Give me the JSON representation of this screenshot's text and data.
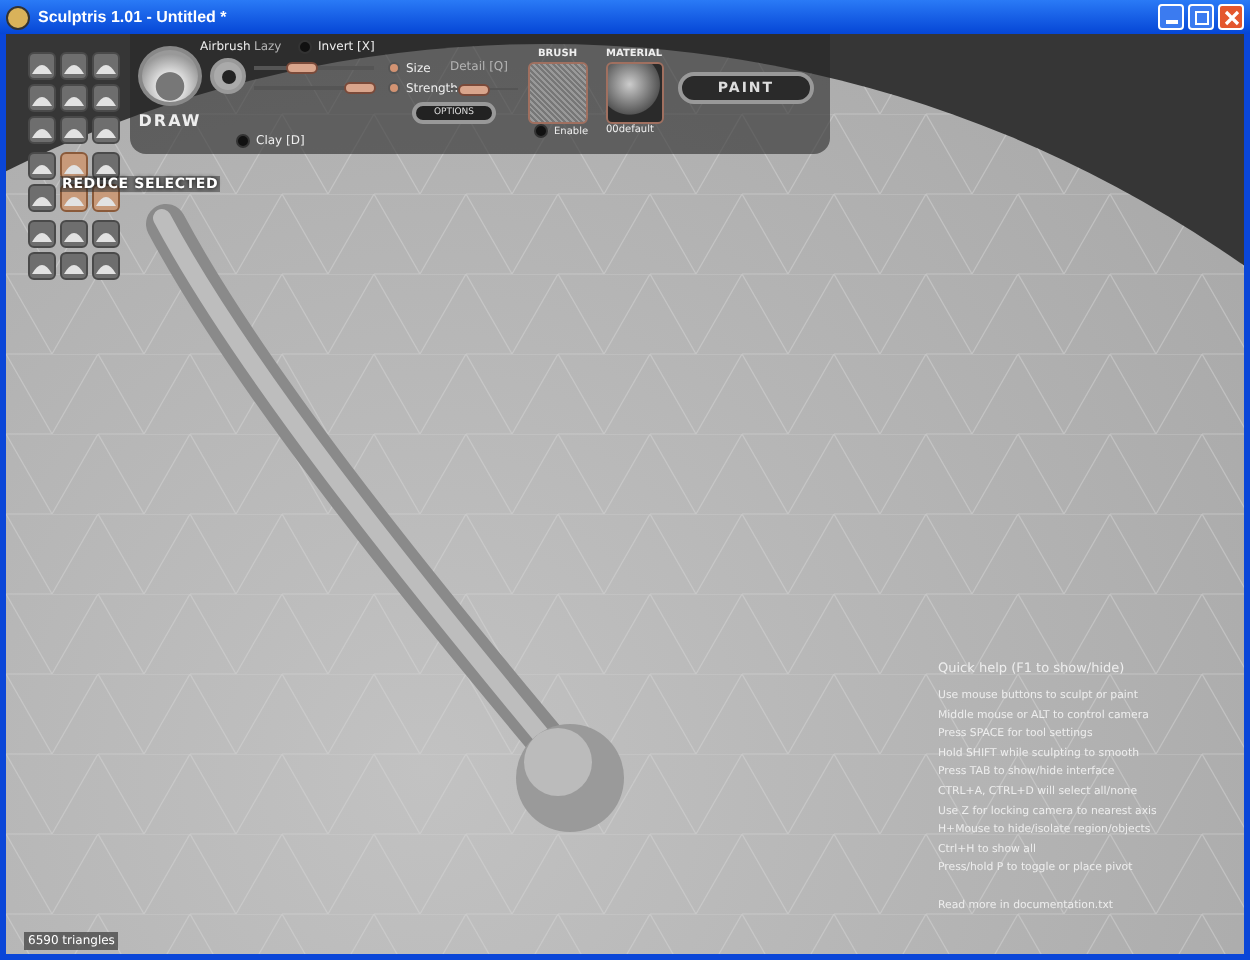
{
  "window": {
    "title": "Sculptris 1.01 - Untitled *"
  },
  "tools": [
    {
      "selected": false
    },
    {
      "selected": false
    },
    {
      "selected": false
    },
    {
      "selected": false
    },
    {
      "selected": false
    },
    {
      "selected": false
    },
    {
      "selected": false
    },
    {
      "selected": false
    },
    {
      "selected": false
    },
    {
      "selected": false
    },
    {
      "selected": true
    },
    {
      "selected": false
    },
    {
      "selected": false
    },
    {
      "selected": true
    },
    {
      "selected": true
    },
    {
      "selected": false
    },
    {
      "selected": false
    },
    {
      "selected": false
    },
    {
      "selected": false
    },
    {
      "selected": false
    },
    {
      "selected": false
    }
  ],
  "tool_label": "REDUCE SELECTED",
  "brush_tool": {
    "name": "DRAW",
    "airbrush": "Airbrush",
    "lazy": {
      "label": "Lazy",
      "disabled": true
    },
    "invert": {
      "label": "Invert [X]",
      "checked": true
    },
    "clay": {
      "label": "Clay [D]",
      "checked": true
    }
  },
  "sliders": [
    {
      "label": "Size",
      "level": 0.4
    },
    {
      "label": "Strength",
      "level": 0.88
    }
  ],
  "detail": {
    "label": "Detail [Q]",
    "disabled": true,
    "level": 0.35
  },
  "options_button": "OPTIONS",
  "brush": {
    "heading": "BRUSH",
    "enable": {
      "label": "Enable",
      "checked": true
    }
  },
  "material": {
    "heading": "MATERIAL",
    "name": "00default"
  },
  "paint_button": "PAINT",
  "help": {
    "title": "Quick help (F1 to show/hide)",
    "lines": [
      "Use mouse buttons to sculpt or paint",
      "Middle mouse or ALT to control camera",
      "Press SPACE for tool settings",
      "Hold SHIFT while sculpting to smooth",
      "Press TAB to show/hide interface",
      "CTRL+A, CTRL+D will select all/none",
      "Use Z for locking camera to nearest axis",
      "H+Mouse to hide/isolate region/objects",
      "Ctrl+H to show all",
      "Press/hold P to toggle or place pivot"
    ],
    "footer": "Read more in documentation.txt"
  },
  "status": "6590 triangles"
}
